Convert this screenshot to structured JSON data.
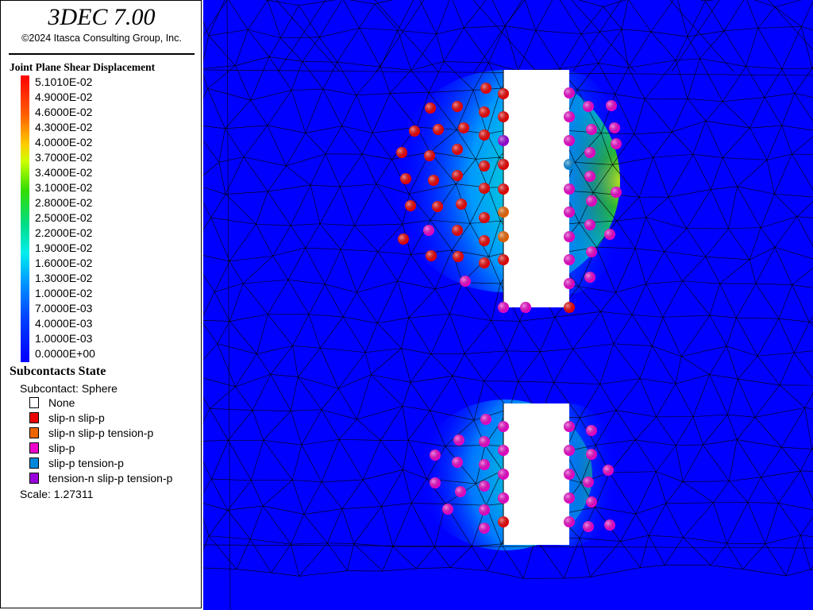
{
  "app": {
    "title": "3DEC 7.00",
    "copyright": "©2024 Itasca Consulting Group, Inc."
  },
  "shear_legend": {
    "title": "Joint Plane Shear Displacement",
    "labels": [
      "5.1010E-02",
      "4.9000E-02",
      "4.6000E-02",
      "4.3000E-02",
      "4.0000E-02",
      "3.7000E-02",
      "3.4000E-02",
      "3.1000E-02",
      "2.8000E-02",
      "2.5000E-02",
      "2.2000E-02",
      "1.9000E-02",
      "1.6000E-02",
      "1.3000E-02",
      "1.0000E-02",
      "7.0000E-03",
      "4.0000E-03",
      "1.0000E-03",
      "0.0000E+00"
    ]
  },
  "state_legend": {
    "title": "Subcontacts State",
    "subcontact_type": "Subcontact: Sphere",
    "items": [
      {
        "label": "None",
        "color": "#ffffff"
      },
      {
        "label": "slip-n slip-p",
        "color": "#ee0000"
      },
      {
        "label": "slip-n slip-p tension-p",
        "color": "#ee6600"
      },
      {
        "label": "slip-p",
        "color": "#ee00cc"
      },
      {
        "label": "slip-p tension-p",
        "color": "#0088dd"
      },
      {
        "label": "tension-n slip-p tension-p",
        "color": "#9900dd"
      }
    ],
    "scale": "Scale: 1.27311"
  },
  "viewport": {
    "background_color": "#0000ff",
    "opening_color": "#ffffff",
    "mesh_color": "#000000"
  }
}
